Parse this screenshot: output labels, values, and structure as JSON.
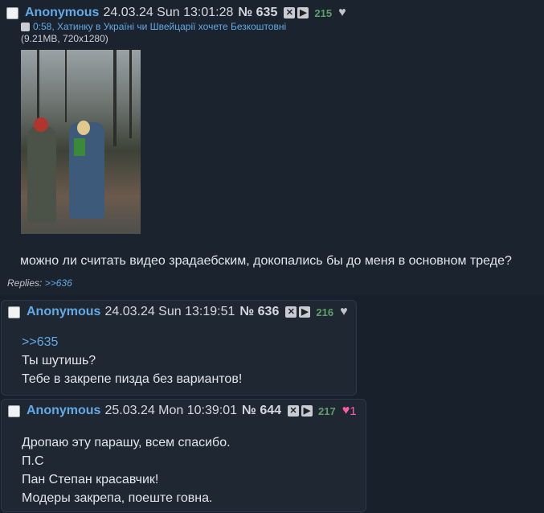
{
  "posts": [
    {
      "name": "Anonymous",
      "date": "24.03.24 Sun 13:01:28",
      "number": "№ 635",
      "count": "215",
      "file": {
        "link": "0:58, Хатинку в Україні чи Швейцарії хочете Безкоштовні",
        "meta": "(9.21MB, 720x1280)"
      },
      "message": [
        "можно ли считать видео зрадаебским, докопались бы до меня в основном треде?"
      ],
      "replies_label": "Replies:",
      "replies_link": ">>636"
    },
    {
      "name": "Anonymous",
      "date": "24.03.24 Sun 13:19:51",
      "number": "№ 636",
      "count": "216",
      "quote": ">>635",
      "message": [
        "Ты шутишь?",
        "Тебе в закрепе пизда без вариантов!"
      ]
    },
    {
      "name": "Anonymous",
      "date": "25.03.24 Mon 10:39:01",
      "number": "№ 644",
      "count": "217",
      "likes": "1",
      "message": [
        "Дропаю эту парашу, всем спасибо.",
        "П.С",
        "Пан Степан красавчик!",
        "Модеры закрепа, поеште говна."
      ]
    }
  ],
  "icons": {
    "hide": "close-icon",
    "play": "play-icon",
    "like": "heart-icon",
    "search": "magnifier-icon"
  },
  "colors": {
    "background": "#17202b",
    "name": "#63a9e6",
    "count": "#5ea06a",
    "like_active": "#ff5ca8"
  }
}
